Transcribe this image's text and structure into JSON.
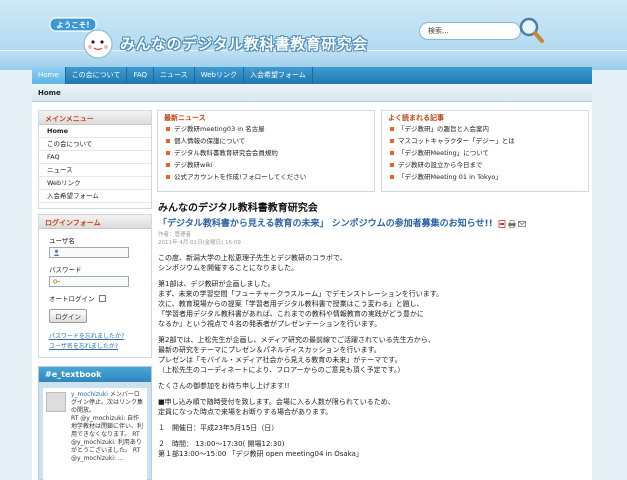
{
  "header": {
    "welcome_badge": "ようこそ!",
    "site_title": "みんなのデジタル教科書教育研究会",
    "search_placeholder": "検索..."
  },
  "nav": {
    "items": [
      "Home",
      "この会について",
      "FAQ",
      "ニュース",
      "Webリンク",
      "入会希望フォーム"
    ],
    "active": "Home"
  },
  "breadcrumb": "Home",
  "sidebar": {
    "menu_title": "メインメニュー",
    "menu_items": [
      "Home",
      "この会について",
      "FAQ",
      "ニュース",
      "Webリンク",
      "入会希望フォーム"
    ],
    "login_title": "ログインフォーム",
    "username_label": "ユーザ名",
    "password_label": "パスワード",
    "autologin_label": "オートログイン",
    "login_button": "ログイン",
    "forgot_password": "パスワードを忘れましたか?",
    "forgot_username": "ユーザ名を忘れましたか?"
  },
  "twitter": {
    "title": "#e_textbook",
    "user": "y_mochizuki",
    "text1": " メンバーログイン停止。次はリンク集の開放。",
    "rt1": "RT @y_mochizuki: 自作地学教材は閉鎖に伴い、利用できなくなります。 RT @y_mochizuki: 利用ありがとうございました。 RT @y_mochizuki: ..."
  },
  "latest_news": {
    "title": "最新ニュース",
    "items": [
      "デジ教研meeting03 in 名古屋",
      "個人情報の保護について",
      "デジタル教科書教育研究会会員規約",
      "デジ教研wiki",
      "公式アカウントを作成!フォローしてください"
    ]
  },
  "popular": {
    "title": "よく読まれる記事",
    "items": [
      "「デジ教研」の趣旨と入会案内",
      "マスコットキャラクター「デジー」とは",
      "「デジ教研Meeting」について",
      "デジ教研の設立から今日まで",
      "「デジ教研Meeting 01 in Tokyo」"
    ]
  },
  "article": {
    "heading": "みんなのデジタル教科書教育研究会",
    "title": "「デジタル教科書から見える教育の未来」 シンポジウムの参加者募集のお知らせ!!",
    "author": "作者：管理者",
    "date": "2011年 4月 01日(金曜日) 16:09",
    "paragraphs": [
      "この度、新潟大学の上松恵理子先生とデジ教研のコラボで、\nシンポジウムを開催することになりました。",
      "第1部は、デジ教研が企画しました。\nまず、未来の学習空間「フューチャークラスルーム」でデモンストレーションを行います。\n次に、教育現場からの提案「学習者用デジタル教科書で授業はこう変わる」と題し、\n「学習者用デジタル教科書があれば、これまでの教科や情報教育の実践がどう豊かに\nなるか」という視点で４名の発表者がプレゼンテーションを行います。",
      "第2部では、上松先生が企画し、メディア研究の最前線でご活躍されている先生方から、\n最新の研究をテーマにプレゼン＆パネルディスカッションを行います。\nプレゼンは「モバイル・メディア社会から見える教育の未来」がテーマです。\n（上松先生のコーディネートにより、フロアーからのご意見も頂く予定です。）",
      "たくさんの御参加をお待ち申し上げます!!",
      "■申し込み順で随時受付を致します。会場に入る人数が限られているため、\n定員になった時点で来場をお断りする場合があります。",
      "１　開催日：平成23年5月15日（日）",
      "２　時間： 13:00〜17:30( 開場12:30)\n第１部13:00〜15:00 「デジ教研 open meeting04 in Osaka」"
    ]
  }
}
